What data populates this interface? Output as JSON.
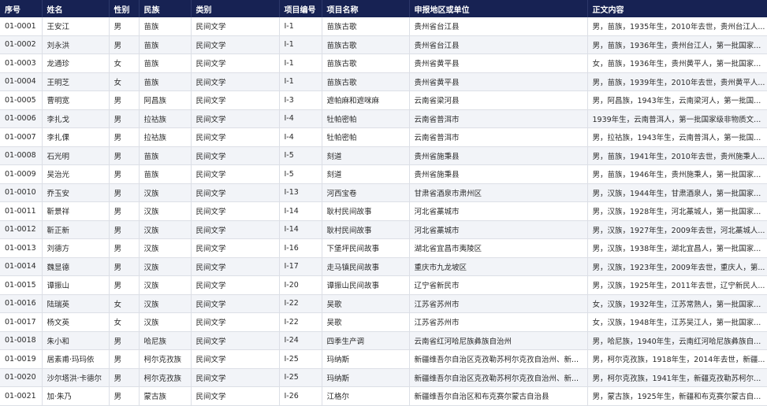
{
  "table": {
    "columns": [
      "序号",
      "姓名",
      "性别",
      "民族",
      "类别",
      "项目编号",
      "项目名称",
      "申报地区或单位",
      "正文内容"
    ],
    "rows": [
      [
        "01-0001",
        "王安江",
        "男",
        "苗族",
        "民间文学",
        "Ⅰ-1",
        "苗族古歌",
        "贵州省台江县",
        "男，苗族，1935年生，2010年去世，贵州台江人..."
      ],
      [
        "01-0002",
        "刘永洪",
        "男",
        "苗族",
        "民间文学",
        "Ⅰ-1",
        "苗族古歌",
        "贵州省台江县",
        "男，苗族，1936年生，贵州台江人，第一批国家..."
      ],
      [
        "01-0003",
        "龙通珍",
        "女",
        "苗族",
        "民间文学",
        "Ⅰ-1",
        "苗族古歌",
        "贵州省黄平县",
        "女，苗族，1936年生，贵州黄平人，第一批国家..."
      ],
      [
        "01-0004",
        "王明芝",
        "女",
        "苗族",
        "民间文学",
        "Ⅰ-1",
        "苗族古歌",
        "贵州省黄平县",
        "男，苗族，1939年生，2010年去世，贵州黄平人..."
      ],
      [
        "01-0005",
        "曹明宽",
        "男",
        "阿昌族",
        "民间文学",
        "Ⅰ-3",
        "遮帕麻和遮咪麻",
        "云南省梁河县",
        "男，阿昌族，1943年生，云南梁河人，第一批国..."
      ],
      [
        "01-0006",
        "李扎戈",
        "男",
        "拉祜族",
        "民间文学",
        "Ⅰ-4",
        "牡帕密帕",
        "云南省普洱市",
        "1939年生，云南普洱人，第一批国家级非物质文..."
      ],
      [
        "01-0007",
        "李扎倮",
        "男",
        "拉祜族",
        "民间文学",
        "Ⅰ-4",
        "牡帕密帕",
        "云南省普洱市",
        "男，拉祜族，1943年生，云南普洱人，第一批国..."
      ],
      [
        "01-0008",
        "石光明",
        "男",
        "苗族",
        "民间文学",
        "Ⅰ-5",
        "刻道",
        "贵州省施秉县",
        "男，苗族，1941年生，2010年去世，贵州施秉人..."
      ],
      [
        "01-0009",
        "吴治光",
        "男",
        "苗族",
        "民间文学",
        "Ⅰ-5",
        "刻道",
        "贵州省施秉县",
        "男，苗族，1946年生，贵州施秉人，第一批国家..."
      ],
      [
        "01-0010",
        "乔玉安",
        "男",
        "汉族",
        "民间文学",
        "Ⅰ-13",
        "河西宝卷",
        "甘肃省酒泉市肃州区",
        "男，汉族，1944年生，甘肃酒泉人，第一批国家..."
      ],
      [
        "01-0011",
        "靳景祥",
        "男",
        "汉族",
        "民间文学",
        "Ⅰ-14",
        "耿村民间故事",
        "河北省藁城市",
        "男，汉族，1928年生，河北藁城人，第一批国家..."
      ],
      [
        "01-0012",
        "靳正新",
        "男",
        "汉族",
        "民间文学",
        "Ⅰ-14",
        "耿村民间故事",
        "河北省藁城市",
        "男，汉族，1927年生，2009年去世，河北藁城人..."
      ],
      [
        "01-0013",
        "刘德方",
        "男",
        "汉族",
        "民间文学",
        "Ⅰ-16",
        "下堡坪民间故事",
        "湖北省宜昌市夷陵区",
        "男，汉族，1938年生，湖北宜昌人，第一批国家..."
      ],
      [
        "01-0014",
        "魏显德",
        "男",
        "汉族",
        "民间文学",
        "Ⅰ-17",
        "走马镇民间故事",
        "重庆市九龙坡区",
        "男，汉族，1923年生，2009年去世，重庆人，第..."
      ],
      [
        "01-0015",
        "谭振山",
        "男",
        "汉族",
        "民间文学",
        "Ⅰ-20",
        "谭振山民间故事",
        "辽宁省新民市",
        "男，汉族，1925年生，2011年去世，辽宁新民人..."
      ],
      [
        "01-0016",
        "陆瑞英",
        "女",
        "汉族",
        "民间文学",
        "Ⅰ-22",
        "吴歌",
        "江苏省苏州市",
        "女，汉族，1932年生，江苏常熟人，第一批国家..."
      ],
      [
        "01-0017",
        "杨文英",
        "女",
        "汉族",
        "民间文学",
        "Ⅰ-22",
        "吴歌",
        "江苏省苏州市",
        "女，汉族，1948年生，江苏吴江人，第一批国家..."
      ],
      [
        "01-0018",
        "朱小和",
        "男",
        "哈尼族",
        "民间文学",
        "Ⅰ-24",
        "四季生产调",
        "云南省红河哈尼族彝族自治州",
        "男，哈尼族，1940年生，云南红河哈尼族彝族自..."
      ],
      [
        "01-0019",
        "居素甫·玛玛依",
        "男",
        "柯尔克孜族",
        "民间文学",
        "Ⅰ-25",
        "玛纳斯",
        "新疆维吾尔自治区克孜勒苏柯尔克孜自治州、新...",
        "男，柯尔克孜族，1918年生，2014年去世，新疆..."
      ],
      [
        "01-0020",
        "沙尔塔洪·卡德尔",
        "男",
        "柯尔克孜族",
        "民间文学",
        "Ⅰ-25",
        "玛纳斯",
        "新疆维吾尔自治区克孜勒苏柯尔克孜自治州、新...",
        "男，柯尔克孜族，1941年生，新疆克孜勒苏柯尔..."
      ],
      [
        "01-0021",
        "加·朱乃",
        "男",
        "蒙古族",
        "民间文学",
        "Ⅰ-26",
        "江格尔",
        "新疆维吾尔自治区和布克赛尔蒙古自治县",
        "男，蒙古族，1925年生，新疆和布克赛尔蒙古自..."
      ]
    ]
  }
}
